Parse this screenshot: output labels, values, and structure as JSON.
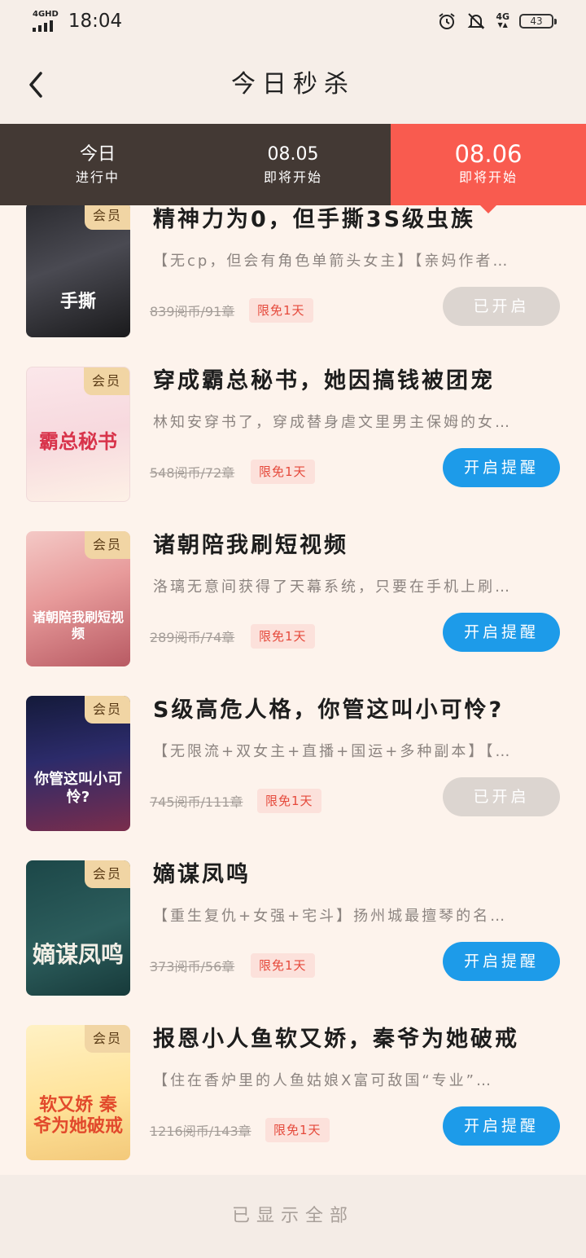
{
  "status": {
    "network": "4GHD",
    "time": "18:04",
    "net_right": "4G",
    "battery": "43"
  },
  "header": {
    "title": "今日秒杀"
  },
  "tabs": [
    {
      "label": "今日",
      "sub": "进行中"
    },
    {
      "label": "08.05",
      "sub": "即将开始"
    },
    {
      "label": "08.06",
      "sub": "即将开始"
    }
  ],
  "colors": {
    "accent": "#f95b4f",
    "tab_bg": "#433934",
    "remind": "#1d9be9",
    "badge": "#f1d5a4"
  },
  "books": [
    {
      "vip": "会员",
      "title": "精神力为0，但手撕3S级虫族",
      "desc": "【无cp，但会有角色单箭头女主】【亲妈作者…",
      "price": "839阅币/91章",
      "tag": "限免1天",
      "button": "已开启",
      "button_state": "off",
      "cover_text": "手撕"
    },
    {
      "vip": "会员",
      "title": "穿成霸总秘书，她因搞钱被团宠",
      "desc": "林知安穿书了，穿成替身虐文里男主保姆的女…",
      "price": "548阅币/72章",
      "tag": "限免1天",
      "button": "开启提醒",
      "button_state": "on",
      "cover_text": "霸总秘书"
    },
    {
      "vip": "会员",
      "title": "诸朝陪我刷短视频",
      "desc": "洛璃无意间获得了天幕系统，只要在手机上刷…",
      "price": "289阅币/74章",
      "tag": "限免1天",
      "button": "开启提醒",
      "button_state": "on",
      "cover_text": "诸朝陪我刷短视频"
    },
    {
      "vip": "会员",
      "title": "S级高危人格，你管这叫小可怜?",
      "desc": "【无限流+双女主+直播+国运+多种副本】【…",
      "price": "745阅币/111章",
      "tag": "限免1天",
      "button": "已开启",
      "button_state": "off",
      "cover_text": "你管这叫小可怜?"
    },
    {
      "vip": "会员",
      "title": "嫡谋凤鸣",
      "desc": "【重生复仇+女强+宅斗】扬州城最擅琴的名…",
      "price": "373阅币/56章",
      "tag": "限免1天",
      "button": "开启提醒",
      "button_state": "on",
      "cover_text": "嫡谋凤鸣"
    },
    {
      "vip": "会员",
      "title": "报恩小人鱼软又娇，秦爷为她破戒",
      "desc": "【住在香炉里的人鱼姑娘X富可敌国“专业”…",
      "price": "1216阅币/143章",
      "tag": "限免1天",
      "button": "开启提醒",
      "button_state": "on",
      "cover_text": "软又娇 秦爷为她破戒"
    }
  ],
  "footer": {
    "text": "已显示全部"
  }
}
